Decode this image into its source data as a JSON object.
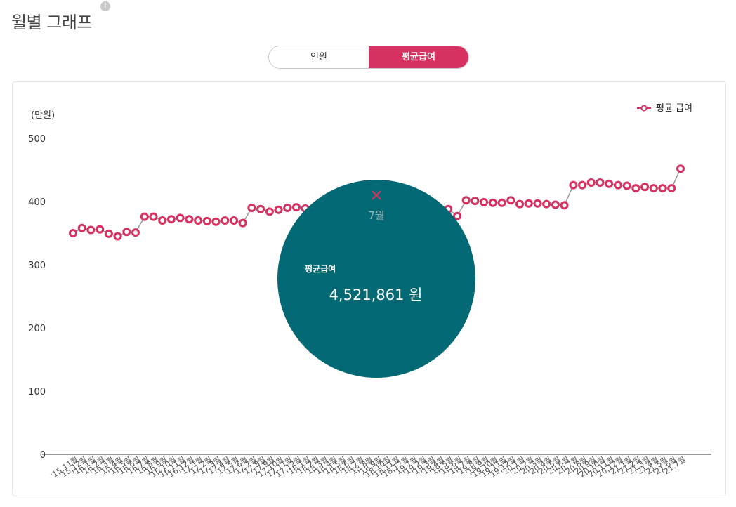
{
  "page": {
    "title": "월별 그래프",
    "info_icon": "info-icon"
  },
  "toggle": {
    "tabs": [
      {
        "label": "인원",
        "active": false
      },
      {
        "label": "평균급여",
        "active": true
      }
    ],
    "active_color": "#d63160"
  },
  "chart_data": {
    "type": "line",
    "unit_label": "(만원)",
    "y_ticks": [
      0,
      100,
      200,
      300,
      400,
      500
    ],
    "ylim": [
      0,
      500
    ],
    "grid": false,
    "legend_position": "top-right",
    "series": [
      {
        "name": "평균 급여",
        "color": "#d63160",
        "values": [
          350,
          358,
          355,
          356,
          349,
          345,
          352,
          351,
          376,
          376,
          370,
          372,
          374,
          372,
          370,
          369,
          368,
          370,
          370,
          366,
          390,
          388,
          384,
          387,
          390,
          391,
          389,
          388,
          388,
          388,
          388,
          388,
          388,
          388,
          388,
          388,
          388,
          388,
          388,
          388,
          388,
          388,
          388,
          377,
          402,
          401,
          399,
          398,
          398,
          402,
          396,
          397,
          397,
          396,
          395,
          394,
          426,
          426,
          430,
          430,
          428,
          426,
          425,
          421,
          423,
          421,
          421,
          421,
          452
        ]
      }
    ],
    "x_labels": [
      "'15.11월",
      "'15.12월",
      "'16.1월",
      "'16.2월",
      "'16.3월",
      "'16.4월",
      "'16.5월",
      "'16.6월",
      "'16.7월",
      "'16.8월",
      "'16.9월",
      "'16.10월",
      "'16.11월",
      "'16.12월",
      "'17.1월",
      "'17.2월",
      "'17.3월",
      "'17.4월",
      "'17.5월",
      "'17.6월",
      "'17.7월",
      "'17.8월",
      "'17.9월",
      "'17.10월",
      "'17.11월",
      "'17.12월",
      "'18.1월",
      "'18.2월",
      "'18.3월",
      "'18.4월",
      "'18.5월",
      "'18.6월",
      "'18.7월",
      "'18.8월",
      "'18.9월",
      "'18.10월",
      "'18.11월",
      "'18.12월",
      "'19.1월",
      "'19.2월",
      "'19.3월",
      "'19.4월",
      "'19.5월",
      "'19.6월",
      "'19.7월",
      "'19.8월",
      "'19.9월",
      "'19.10월",
      "'19.11월",
      "'19.12월",
      "'20.1월",
      "'20.2월",
      "'20.3월",
      "'20.4월",
      "'20.5월",
      "'20.6월",
      "'20.7월",
      "'20.8월",
      "'20.9월",
      "'20.10월",
      "'20.11월",
      "'20.12월",
      "'21.1월",
      "'21.2월",
      "'21.3월",
      "'21.4월",
      "'21.5월",
      "'21.6월",
      "'21.7월"
    ],
    "tooltip": {
      "month": "7월",
      "label": "평균급여",
      "value": "4,521,861 원",
      "close_icon": "close-icon",
      "color": "#036a75"
    }
  }
}
